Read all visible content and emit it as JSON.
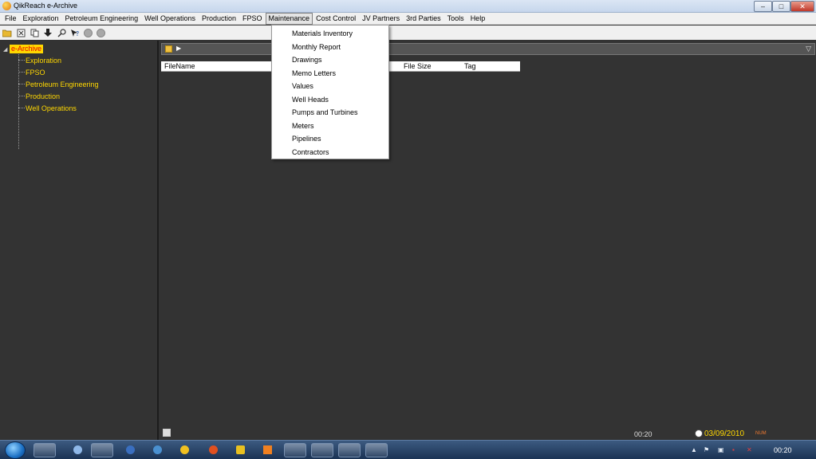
{
  "window": {
    "title": "QikReach e-Archive",
    "controls": {
      "minimize": "–",
      "maximize": "□",
      "close": "✕"
    }
  },
  "menubar": {
    "items": [
      "File",
      "Exploration",
      "Petroleum Engineering",
      "Well Operations",
      "Production",
      "FPSO",
      "Maintenance",
      "Cost Control",
      "JV Partners",
      "3rd Parties",
      "Tools",
      "Help"
    ],
    "active": "Maintenance"
  },
  "toolbar": {
    "icons": [
      "open-folder-icon",
      "cut-icon",
      "copy-icon",
      "download-icon",
      "find-icon",
      "help-icon",
      "back-icon",
      "forward-icon"
    ]
  },
  "tree": {
    "root": "e-Archive",
    "children": [
      "Exploration",
      "FPSO",
      "Petroleum Engineering",
      "Production",
      "Well Operations"
    ]
  },
  "file_list": {
    "columns": [
      "FileName",
      "File Size",
      "Tag"
    ]
  },
  "dropdown": {
    "items": [
      "Materials Inventory",
      "Monthly Report",
      "Drawings",
      "Memo Letters",
      "Values",
      "Well Heads",
      "Pumps and Turbines",
      "Meters",
      "Pipelines",
      "Contractors"
    ]
  },
  "statusbar": {
    "time": "00:20",
    "date": "03/09/2010",
    "num": "NUM"
  },
  "taskbar": {
    "clock": "00:20"
  },
  "colors": {
    "tree_label": "#ffd700",
    "root_highlight": "#ffd700",
    "panel_background": "#333333"
  }
}
